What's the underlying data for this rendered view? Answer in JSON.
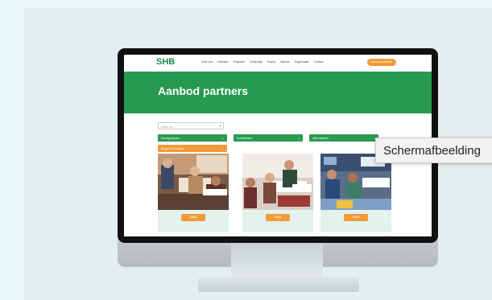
{
  "website": {
    "logo": "SHB",
    "nav": [
      "Over ons",
      "Partners",
      "Projecten",
      "Onderwijs",
      "Teams",
      "Nieuws",
      "Organisatie",
      "Contact"
    ],
    "nav_cta": "Aanbod partners",
    "hero_title": "Aanbod partners",
    "search_placeholder": "Zoek op...",
    "filters": [
      "Doelgroepen",
      "Activiteiten",
      "Alle kanten"
    ],
    "filter_orange": "Begeleide route",
    "card_button": "Bekijk"
  },
  "tooltip": "Schermafbeelding",
  "colors": {
    "brand_green": "#259a50",
    "accent_orange": "#f19a38",
    "background": "#eaf8f9"
  }
}
